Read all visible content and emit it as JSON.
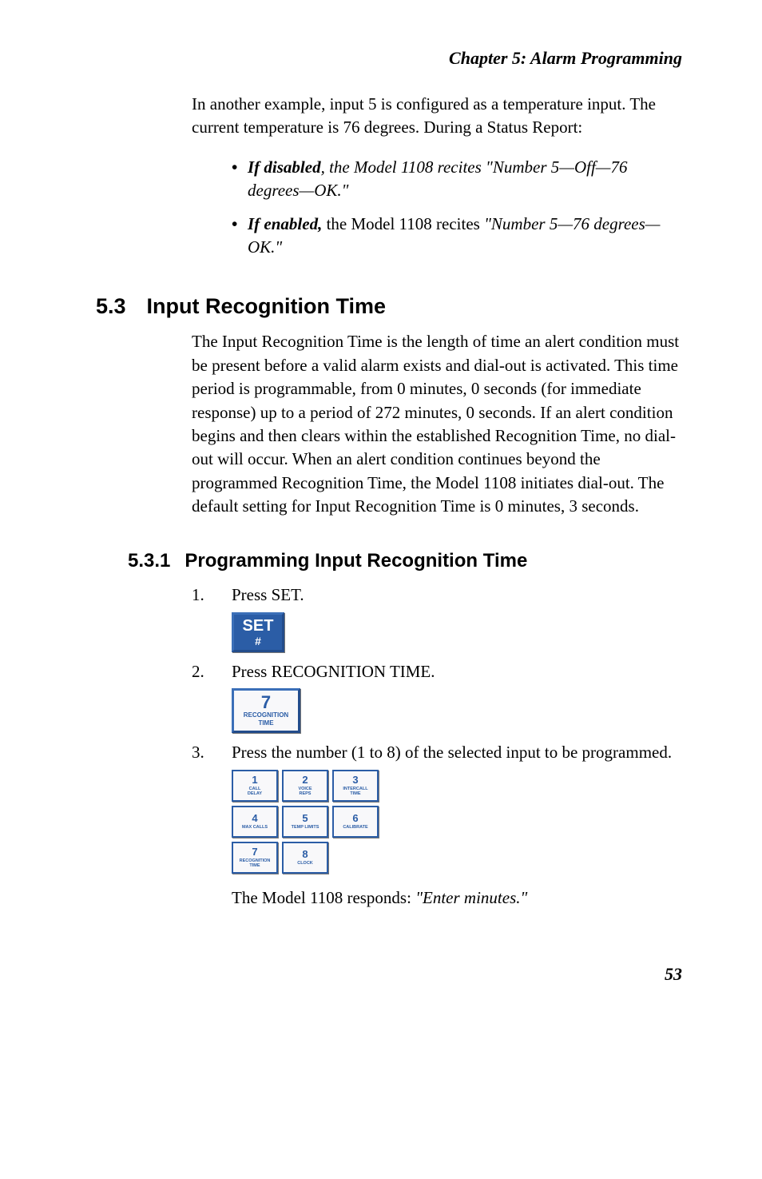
{
  "chapter_header": "Chapter  5:  Alarm Programming",
  "intro_para": "In another example, input 5 is configured as a temperature input. The current temperature is 76 degrees. During a Status Report:",
  "bullets": [
    {
      "lead_bi": "If disabled",
      "lead_after": ", the Model 1108 recites ",
      "quote": "\"Number 5—Off—76 degrees—OK.\""
    },
    {
      "lead_bi": "If enabled,",
      "lead_after": " the Model 1108 recites ",
      "quote": "\"Number 5—76 degrees—OK.\""
    }
  ],
  "h2": {
    "num": "5.3",
    "title": "Input Recognition Time"
  },
  "h2_para": "The Input Recognition Time is the length of time an alert condition must be present before a valid alarm exists and dial-out is activated. This time period is programmable, from 0 minutes, 0 seconds (for immediate response) up to a period of 272 minutes, 0 seconds. If an alert condition begins and then clears within the established Recognition Time, no dial-out will occur. When an alert condition continues beyond the programmed Recognition Time, the Model 1108 initiates dial-out. The default setting for Input Recognition Time is 0 minutes, 3 seconds.",
  "h3": {
    "num": "5.3.1",
    "title": "Programming Input Recognition Time"
  },
  "steps": {
    "s1": {
      "num": "1.",
      "text": "Press SET."
    },
    "s2": {
      "num": "2.",
      "text": "Press RECOGNITION TIME."
    },
    "s3": {
      "num": "3.",
      "text": "Press the number (1 to 8) of the selected input to be programmed."
    }
  },
  "buttons": {
    "set": {
      "line1": "SET",
      "line2": "#"
    },
    "rec": {
      "num": "7",
      "label1": "RECOGNITION",
      "label2": "TIME"
    }
  },
  "keypad": [
    {
      "n": "1",
      "l1": "CALL",
      "l2": "DELAY"
    },
    {
      "n": "2",
      "l1": "VOICE",
      "l2": "REPS"
    },
    {
      "n": "3",
      "l1": "INTERCALL",
      "l2": "TIME"
    },
    {
      "n": "4",
      "l1": "MAX CALLS",
      "l2": ""
    },
    {
      "n": "5",
      "l1": "TEMP LIMITS",
      "l2": ""
    },
    {
      "n": "6",
      "l1": "CALIBRATE",
      "l2": ""
    },
    {
      "n": "7",
      "l1": "RECOGNITION",
      "l2": "TIME"
    },
    {
      "n": "8",
      "l1": "CLOCK",
      "l2": ""
    }
  ],
  "response": {
    "prefix": "The Model 1108 responds: ",
    "quote": "\"Enter minutes.\""
  },
  "page_number": "53"
}
